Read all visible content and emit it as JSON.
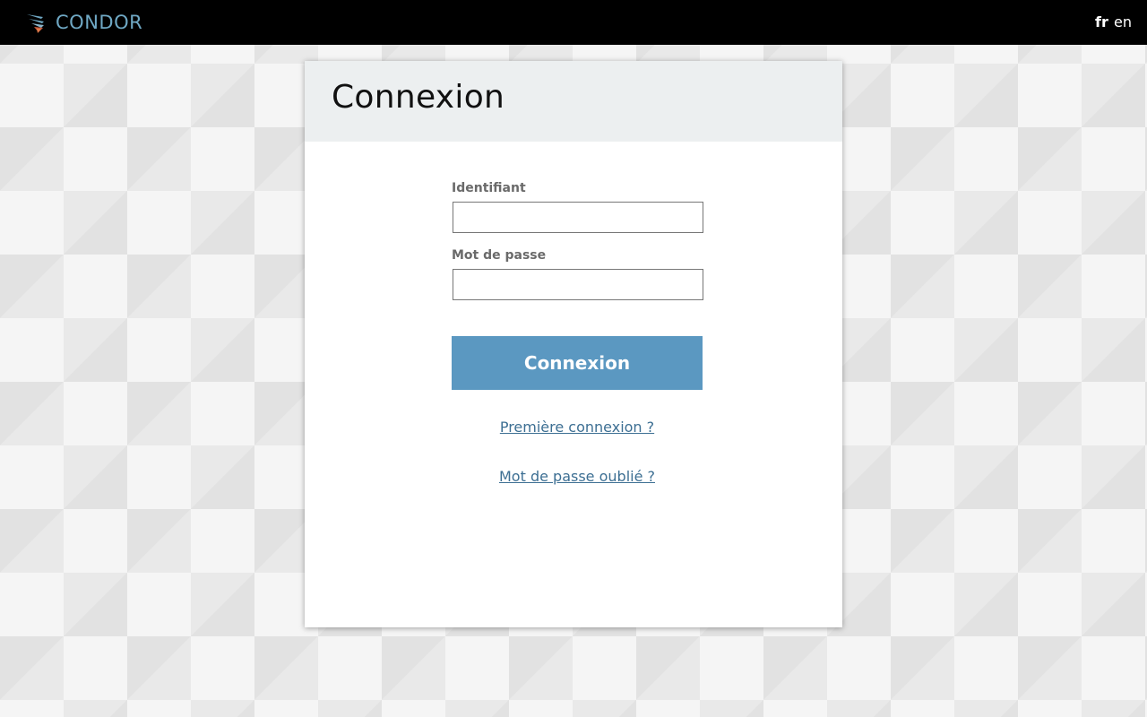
{
  "topbar": {
    "brand": "CONDOR",
    "languages": [
      {
        "code": "fr",
        "active": true
      },
      {
        "code": "en",
        "active": false
      }
    ]
  },
  "login": {
    "title": "Connexion",
    "username_label": "Identifiant",
    "username_value": "",
    "password_label": "Mot de passe",
    "password_value": "",
    "submit_label": "Connexion",
    "first_login_link": "Première connexion ?",
    "forgot_password_link": "Mot de passe oublié ?"
  },
  "colors": {
    "topbar": "#000000",
    "brand": "#6fa8c4",
    "button": "#5b98c1",
    "link": "#3d6f93",
    "header_bg": "#eceff0"
  }
}
